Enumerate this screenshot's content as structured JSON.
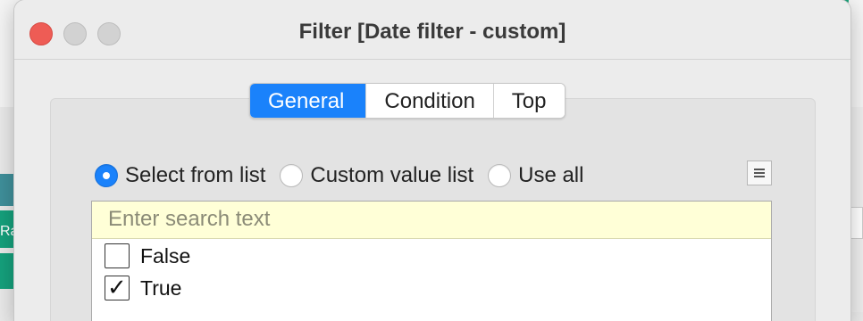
{
  "window": {
    "title": "Filter [Date filter - custom]"
  },
  "tabs": [
    {
      "label": "General",
      "active": true
    },
    {
      "label": "Condition",
      "active": false
    },
    {
      "label": "Top",
      "active": false
    }
  ],
  "selection_mode": {
    "options": [
      {
        "label": "Select from list",
        "selected": true
      },
      {
        "label": "Custom value list",
        "selected": false
      },
      {
        "label": "Use all",
        "selected": false
      }
    ],
    "menu_icon": "hamburger-menu-icon"
  },
  "list": {
    "search_placeholder": "Enter search text",
    "search_value": "",
    "items": [
      {
        "label": "False",
        "checked": false
      },
      {
        "label": "True",
        "checked": true
      }
    ]
  },
  "background": {
    "left_label": "Ra"
  },
  "colors": {
    "accent": "#1a82fb",
    "close": "#ee5c55",
    "search_bg": "#ffffd7"
  }
}
